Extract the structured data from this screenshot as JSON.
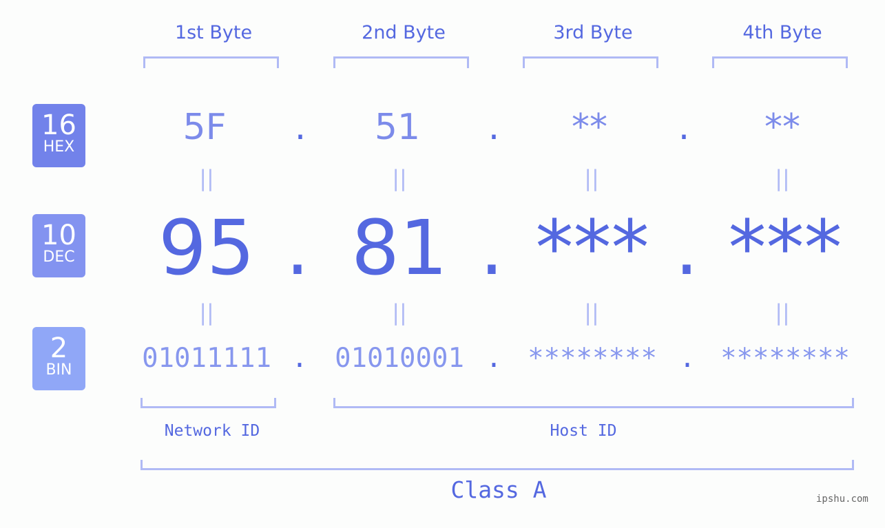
{
  "byte_headers": [
    "1st Byte",
    "2nd Byte",
    "3rd Byte",
    "4th Byte"
  ],
  "badges": {
    "hex": {
      "num": "16",
      "label": "HEX",
      "color": "#7282ea"
    },
    "dec": {
      "num": "10",
      "label": "DEC",
      "color": "#8393f0"
    },
    "bin": {
      "num": "2",
      "label": "BIN",
      "color": "#90a7f7"
    }
  },
  "hex": [
    "5F",
    "51",
    "**",
    "**"
  ],
  "dec": [
    "95",
    "81",
    "***",
    "***"
  ],
  "bin": [
    "01011111",
    "01010001",
    "********",
    "********"
  ],
  "separator": ".",
  "equals": "||",
  "network_label": "Network ID",
  "host_label": "Host ID",
  "class_label": "Class A",
  "watermark": "ipshu.com"
}
